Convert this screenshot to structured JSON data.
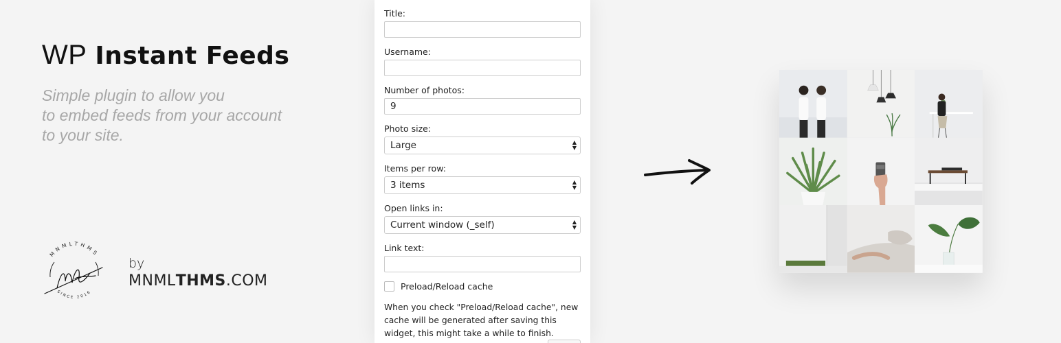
{
  "hero": {
    "title_light": "WP",
    "title_bold": "Instant Feeds",
    "subtitle_lines": [
      "Simple plugin to allow you",
      "to embed feeds from your account",
      "to your site."
    ]
  },
  "brand": {
    "logo_text_top": "MNMLTHMS",
    "logo_text_bottom": "SINCE 2016",
    "by": "by",
    "site_light_1": "MNML",
    "site_bold": "THMS",
    "site_light_2": ".COM"
  },
  "widget": {
    "title_label": "Title:",
    "title_value": "",
    "username_label": "Username:",
    "username_value": "",
    "photos_label": "Number of photos:",
    "photos_value": "9",
    "size_label": "Photo size:",
    "size_value": "Large",
    "per_row_label": "Items per row:",
    "per_row_value": "3 items",
    "open_links_label": "Open links in:",
    "open_links_value": "Current window (_self)",
    "link_text_label": "Link text:",
    "link_text_value": "",
    "cache_label": "Preload/Reload cache",
    "cache_checked": false,
    "help_text": "When you check \"Preload/Reload cache\", new cache will be generated after saving this widget, this might take a while to finish."
  },
  "feed": {
    "photos": [
      "two-people-photo",
      "pendant-lamps-photo",
      "person-at-desk-photo",
      "aloe-plant-photo",
      "hand-holding-cup-photo",
      "bench-photo",
      "white-wall-grass-photo",
      "person-resting-photo",
      "monstera-leaf-photo"
    ]
  }
}
